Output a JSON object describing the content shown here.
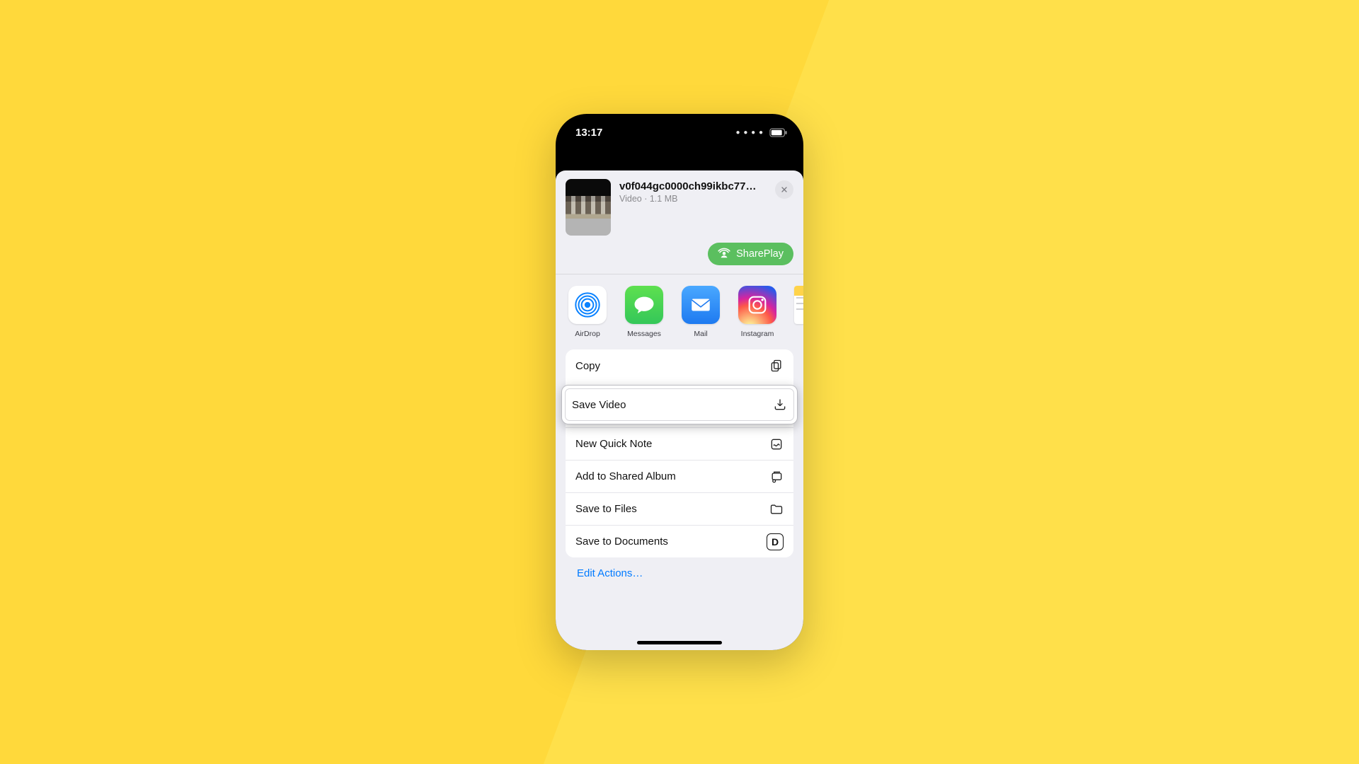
{
  "status": {
    "time": "13:17"
  },
  "header": {
    "filename": "v0f044gc0000ch99ikbc77…",
    "subtitle": "Video · 1.1 MB",
    "shareplay_label": "SharePlay"
  },
  "apps": {
    "airdrop": "AirDrop",
    "messages": "Messages",
    "mail": "Mail",
    "instagram": "Instagram"
  },
  "actions": {
    "copy": "Copy",
    "save_video": "Save Video",
    "new_quick_note": "New Quick Note",
    "add_shared_album": "Add to Shared Album",
    "save_to_files": "Save to Files",
    "save_to_documents": "Save to Documents"
  },
  "edit_actions": "Edit Actions…"
}
